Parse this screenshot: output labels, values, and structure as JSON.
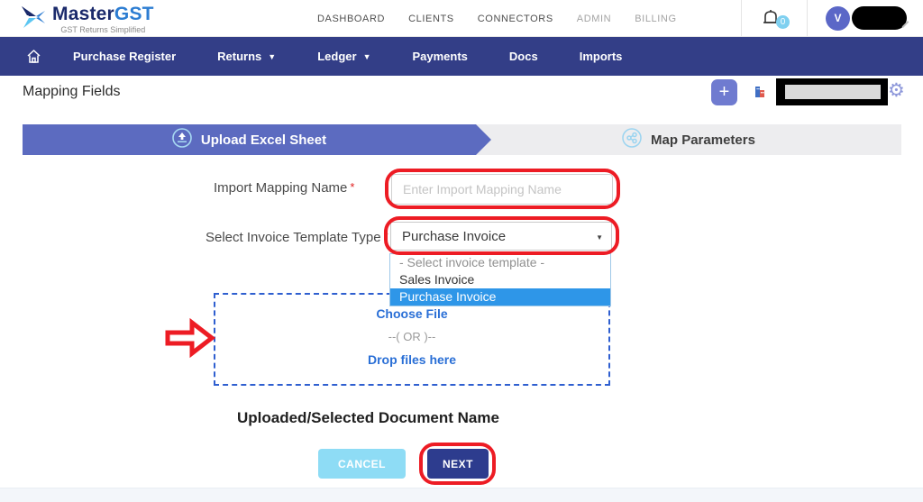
{
  "header": {
    "logo": {
      "title_master": "Master",
      "title_gst": "GST",
      "subtitle": "GST Returns Simplified"
    },
    "nav": [
      {
        "label": "DASHBOARD"
      },
      {
        "label": "CLIENTS"
      },
      {
        "label": "CONNECTORS"
      },
      {
        "label": "ADMIN"
      },
      {
        "label": "BILLING"
      }
    ],
    "notifications_count": "0",
    "avatar_letter": "V"
  },
  "navbar": {
    "items": [
      {
        "label": "Purchase Register"
      },
      {
        "label": "Returns"
      },
      {
        "label": "Ledger"
      },
      {
        "label": "Payments"
      },
      {
        "label": "Docs"
      },
      {
        "label": "Imports"
      }
    ],
    "add_label": "+"
  },
  "page": {
    "title": "Mapping Fields",
    "steps": [
      {
        "label": "Upload Excel Sheet"
      },
      {
        "label": "Map Parameters"
      }
    ],
    "form": {
      "required_mark": "*",
      "mapping_name_label": "Import Mapping Name",
      "mapping_name_placeholder": "Enter Import Mapping Name",
      "template_type_label": "Select Invoice Template Type",
      "template_type_value": "Purchase Invoice",
      "dropdown_options": [
        {
          "label": "- Select invoice template -"
        },
        {
          "label": "Sales Invoice"
        },
        {
          "label": "Purchase Invoice"
        }
      ]
    },
    "dropzone": {
      "choose_file": "Choose File",
      "or": "--( OR )--",
      "drop_files": "Drop files here"
    },
    "document_heading": "Uploaded/Selected Document Name",
    "buttons": {
      "cancel": "CANCEL",
      "next": "NEXT"
    }
  },
  "icons": {
    "bell-icon": "outline bell",
    "gear-icon": "⚙",
    "home-icon": "house outline",
    "upload-icon": "circled up-arrow on tray",
    "map-parameters-icon": "circled share nodes",
    "chevron-down-icon": "▾",
    "red-arrow-annotation": "hollow right arrow"
  },
  "colors": {
    "navbar_blue": "#333e87",
    "step_active_indigo": "#5c6bc0",
    "annotation_red": "#ed1c24",
    "link_blue": "#2a6fd6",
    "dropdown_highlight": "#2e96e8",
    "cancel_button": "#8edcf5",
    "next_button": "#2d3c8e",
    "logo_dark": "#1b2a6b",
    "logo_light": "#2d7dd2"
  }
}
